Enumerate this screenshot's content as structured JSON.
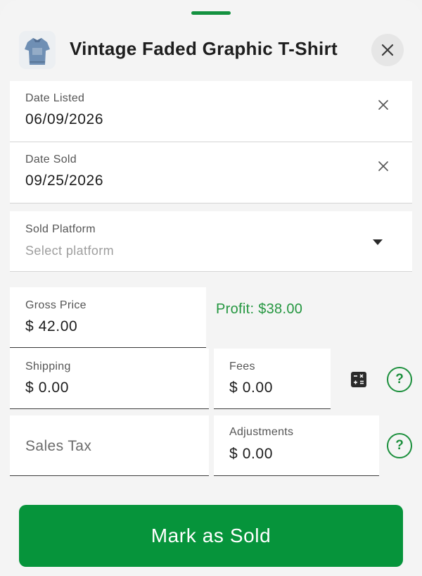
{
  "colors": {
    "accent_green": "#06943b",
    "profit_green": "#23963f",
    "sheet_bg": "#f4f4f4",
    "field_bg": "#ffffff"
  },
  "header": {
    "title": "Vintage Faded Graphic T-Shirt",
    "thumbnail_icon": "tshirt-thumbnail",
    "close_icon": "close-icon"
  },
  "date_listed": {
    "label": "Date Listed",
    "value": "06/09/2026",
    "clear_icon": "clear-icon"
  },
  "date_sold": {
    "label": "Date Sold",
    "value": "09/25/2026",
    "clear_icon": "clear-icon"
  },
  "sold_platform": {
    "label": "Sold Platform",
    "placeholder": "Select platform",
    "dropdown_icon": "chevron-down-icon"
  },
  "gross_price": {
    "label": "Gross Price",
    "value": "$ 42.00"
  },
  "profit": {
    "label": "Profit:",
    "value": "$38.00"
  },
  "shipping": {
    "label": "Shipping",
    "value": "$ 0.00"
  },
  "fees": {
    "label": "Fees",
    "value": "$ 0.00",
    "calculator_icon": "calculator-icon",
    "help_icon": "help-icon",
    "help_text": "?"
  },
  "sales_tax": {
    "placeholder": "Sales Tax"
  },
  "adjustments": {
    "label": "Adjustments",
    "value": "$ 0.00",
    "help_icon": "help-icon",
    "help_text": "?"
  },
  "actions": {
    "mark_sold_label": "Mark as Sold"
  }
}
